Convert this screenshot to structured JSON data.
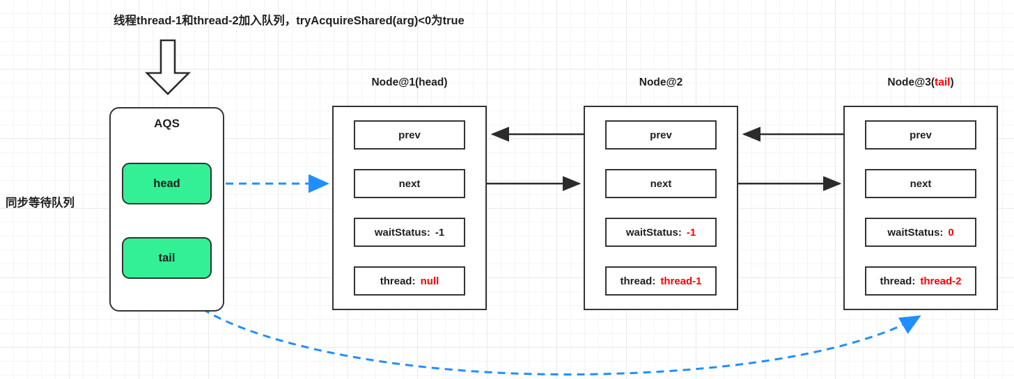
{
  "caption": "线程thread-1和thread-2加入队列，tryAcquireShared(arg)<0为true",
  "queue_label": "同步等待队列",
  "colors": {
    "accent_red": "#ff0000",
    "node_green": "#33F095",
    "stroke": "#333333",
    "link_blue": "#1f8fff"
  },
  "aqs": {
    "title": "AQS",
    "fields": [
      {
        "label": "head"
      },
      {
        "label": "tail"
      }
    ]
  },
  "nodes": [
    {
      "title_main": "Node@1",
      "title_paren_open": "(",
      "title_accent": "head",
      "title_paren_close": ")",
      "accent_color": "#1f1f1f",
      "fields": [
        {
          "label": "prev",
          "value": "",
          "value_color": "none"
        },
        {
          "label": "next",
          "value": "",
          "value_color": "none"
        },
        {
          "label": "waitStatus:",
          "value": "-1",
          "value_color": "black"
        },
        {
          "label": "thread:",
          "value": "null",
          "value_color": "red"
        }
      ]
    },
    {
      "title_main": "Node@2",
      "title_paren_open": "",
      "title_accent": "",
      "title_paren_close": "",
      "accent_color": "#1f1f1f",
      "fields": [
        {
          "label": "prev",
          "value": "",
          "value_color": "none"
        },
        {
          "label": "next",
          "value": "",
          "value_color": "none"
        },
        {
          "label": "waitStatus:",
          "value": "-1",
          "value_color": "red"
        },
        {
          "label": "thread:",
          "value": "thread-1",
          "value_color": "red"
        }
      ]
    },
    {
      "title_main": "Node@3",
      "title_paren_open": "(",
      "title_accent": "tail",
      "title_paren_close": ")",
      "accent_color": "#ff0000",
      "fields": [
        {
          "label": "prev",
          "value": "",
          "value_color": "none"
        },
        {
          "label": "next",
          "value": "",
          "value_color": "none"
        },
        {
          "label": "waitStatus:",
          "value": "0",
          "value_color": "red"
        },
        {
          "label": "thread:",
          "value": "thread-2",
          "value_color": "red"
        }
      ]
    }
  ],
  "connectors": {
    "down_arrow": "block-down-arrow",
    "head_link": "head-to-node1-dashed-arrow",
    "tail_link": "tail-to-node3-dashed-curve",
    "prev_links": [
      "node2-prev-to-node1",
      "node3-prev-to-node2"
    ],
    "next_links": [
      "node1-next-to-node2",
      "node2-next-to-node3"
    ]
  }
}
